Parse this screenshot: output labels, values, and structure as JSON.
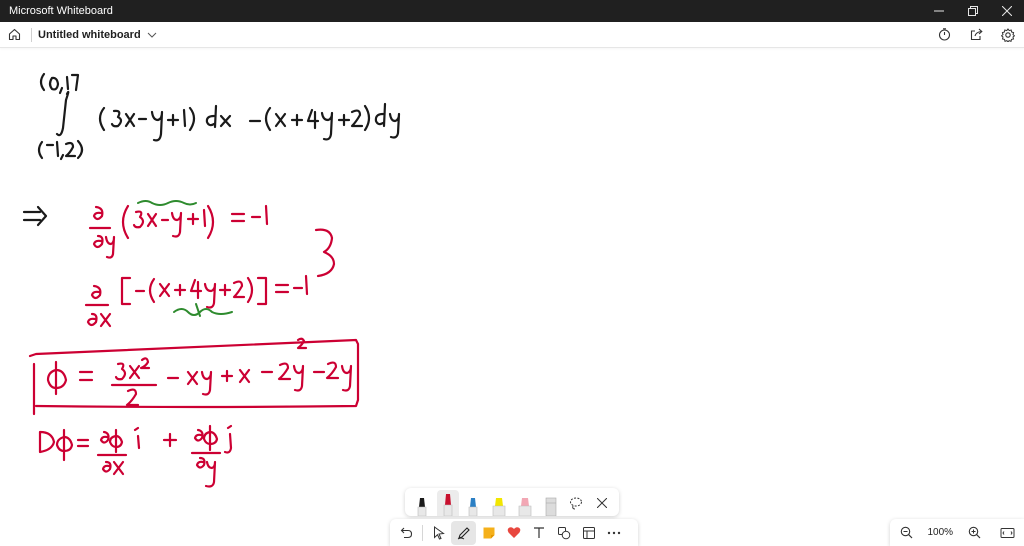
{
  "window": {
    "title": "Microsoft Whiteboard",
    "controls": [
      "minimize-icon",
      "restore-icon",
      "close-icon"
    ]
  },
  "appbar": {
    "board_title": "Untitled whiteboard",
    "left_icons": [
      "home-icon",
      "chevron-down-icon"
    ],
    "right_icons": [
      "timer-icon",
      "share-icon",
      "settings-icon"
    ]
  },
  "canvas": {
    "ink_color_black": "#1a1a1a",
    "ink_color_red": "#cc0033",
    "ink_color_green": "#2e8b2e",
    "ink_lines": [
      "(0,1)",
      "∫ ( 3x - y + 1 ) dx  - ( x + 4y + 2 ) dy",
      "(-1,2)",
      "⇒",
      "∂/∂y ( 3x - y + 1 ) = -1",
      "∂/∂x [ - ( x + 4y + 2 ) ] = -1",
      "φ = 3x²/2 - xy + x - 2y² - 2y",
      "∇φ = ∂φ/∂x î + ∂φ/∂y ĵ"
    ]
  },
  "pen_tray": {
    "pens": [
      {
        "name": "black-pen",
        "color": "#1a1a1a",
        "selected": false
      },
      {
        "name": "red-pen",
        "color": "#c8102e",
        "selected": true
      },
      {
        "name": "blue-pen",
        "color": "#2b7fc4",
        "selected": false
      },
      {
        "name": "yellow-highlighter",
        "color": "#f2e600",
        "selected": false
      },
      {
        "name": "pink-highlighter",
        "color": "#f2a7b4",
        "selected": false
      },
      {
        "name": "eraser",
        "color": "#bdbdbd",
        "selected": false
      }
    ],
    "icons": [
      "lasso-icon",
      "close-icon"
    ]
  },
  "toolbar": {
    "icons": [
      "undo-icon",
      "select-icon",
      "pen-icon",
      "sticky-note-icon",
      "reaction-icon",
      "text-icon",
      "shapes-icon",
      "template-icon",
      "more-icon"
    ]
  },
  "zoom": {
    "level": "100%",
    "icons": [
      "zoom-out-icon",
      "zoom-in-icon",
      "fit-screen-icon"
    ]
  }
}
